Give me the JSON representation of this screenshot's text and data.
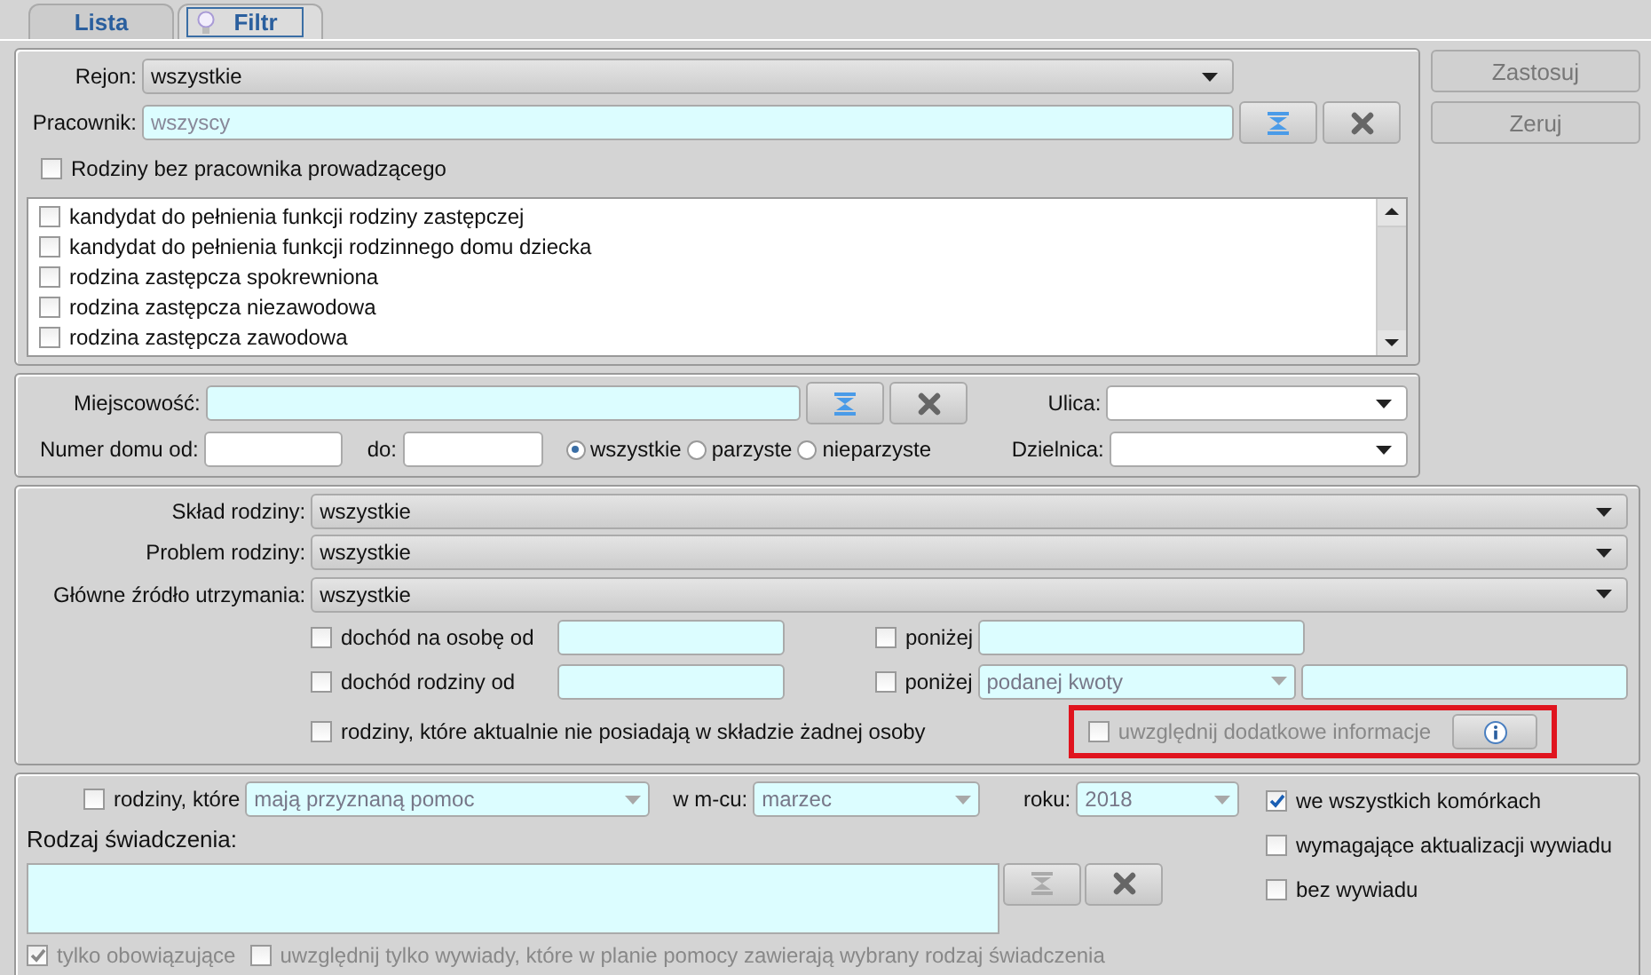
{
  "tabs": [
    {
      "label": "Lista",
      "selected": false
    },
    {
      "label": "Filtr",
      "selected": true
    }
  ],
  "actions": [
    {
      "label": "Zastosuj",
      "disabled": true
    },
    {
      "label": "Zeruj",
      "disabled": true
    }
  ],
  "worker_section": {
    "region": {
      "label": "Rejon:",
      "value": "wszystkie"
    },
    "worker": {
      "label": "Pracownik:",
      "placeholder": "wszyscy"
    },
    "no_worker": {
      "label": "Rodziny bez pracownika prowadzącego",
      "checked": false
    },
    "family_types": [
      {
        "label": "kandydat do pełnienia funkcji rodziny zastępczej",
        "checked": false
      },
      {
        "label": "kandydat do pełnienia funkcji rodzinnego domu dziecka",
        "checked": false
      },
      {
        "label": "rodzina zastępcza spokrewniona",
        "checked": false
      },
      {
        "label": "rodzina zastępcza niezawodowa",
        "checked": false
      },
      {
        "label": "rodzina zastępcza zawodowa",
        "checked": false
      }
    ]
  },
  "address": {
    "city_label": "Miejscowość:",
    "street_label": "Ulica:",
    "house_from_label": "Numer domu od:",
    "house_to_label": "do:",
    "district_label": "Dzielnica:",
    "parity": [
      {
        "label": "wszystkie",
        "selected": true
      },
      {
        "label": "parzyste",
        "selected": false
      },
      {
        "label": "nieparzyste",
        "selected": false
      }
    ]
  },
  "family": {
    "dropdowns": [
      {
        "label": "Skład rodziny:",
        "value": "wszystkie"
      },
      {
        "label": "Problem rodziny:",
        "value": "wszystkie"
      },
      {
        "label": "Główne źródło utrzymania:",
        "value": "wszystkie"
      }
    ],
    "income_per_person": {
      "label": "dochód na osobę od",
      "checked": false,
      "below_label": "poniżej",
      "below_checked": false
    },
    "income_family": {
      "label": "dochód rodziny od",
      "checked": false,
      "below_label": "poniżej",
      "below_checked": false,
      "below_mode": "podanej kwoty"
    },
    "no_members": {
      "label": "rodziny, które aktualnie nie posiadają w składzie żadnej osoby",
      "checked": false
    },
    "extra_info": {
      "label": "uwzględnij dodatkowe informacje",
      "checked": false,
      "disabled": true,
      "highlighted": true
    }
  },
  "assistance": {
    "filter": {
      "label": "rodziny, które",
      "checked": false,
      "mode": "mają przyznaną pomoc"
    },
    "month": {
      "label": "w m-cu:",
      "value": "marzec"
    },
    "year": {
      "label": "roku:",
      "value": "2018"
    },
    "options": [
      {
        "label": "we wszystkich komórkach",
        "checked": true
      },
      {
        "label": "wymagające aktualizacji wywiadu",
        "checked": false
      },
      {
        "label": "bez wywiadu",
        "checked": false
      }
    ],
    "benefit_label": "Rodzaj świadczenia:",
    "only_current": {
      "label": "tylko obowiązujące",
      "checked": true,
      "disabled": true
    },
    "only_plans": {
      "label": "uwzględnij tylko wywiady, które w planie pomocy zawierają wybrany rodzaj świadczenia",
      "checked": false,
      "disabled": true
    }
  }
}
